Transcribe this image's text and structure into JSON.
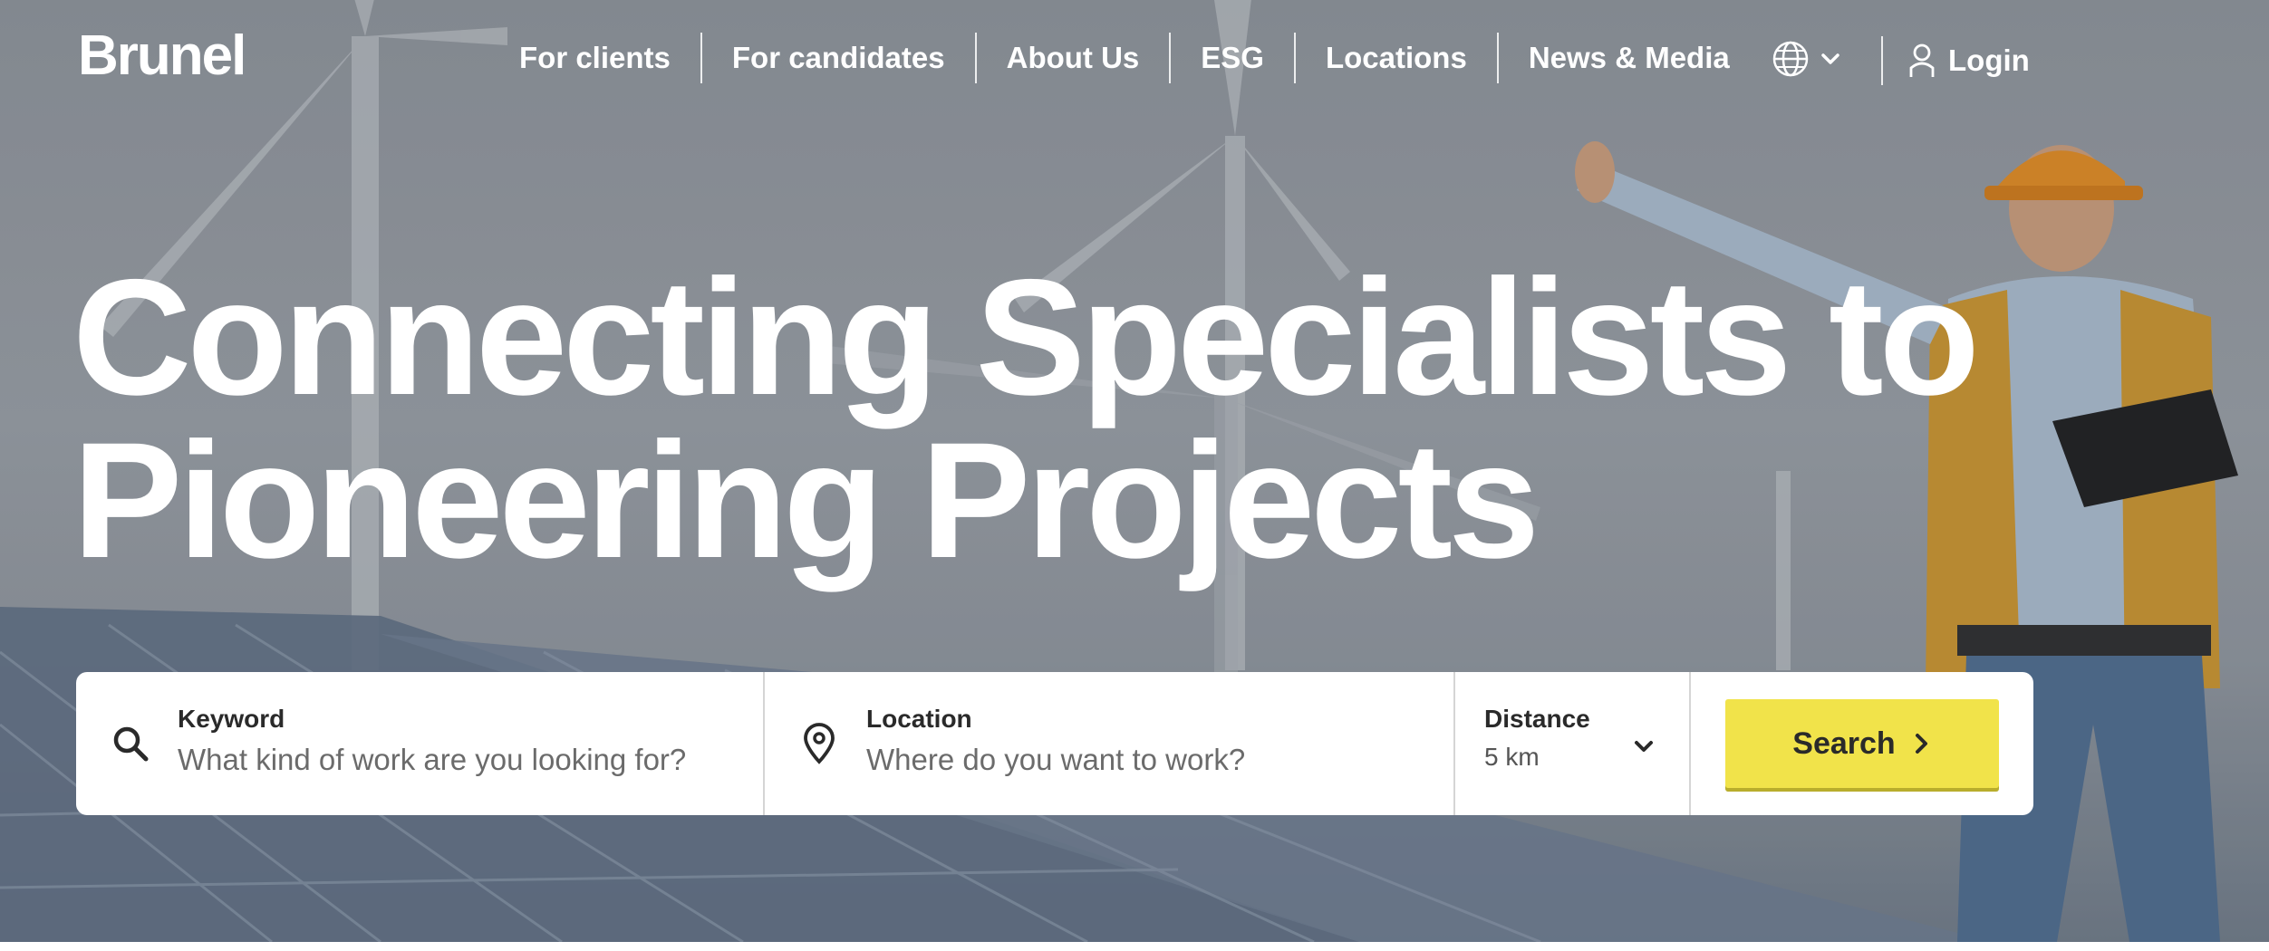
{
  "brand": {
    "logo_text": "Brunel"
  },
  "nav": {
    "items": [
      {
        "label": "For clients"
      },
      {
        "label": "For candidates"
      },
      {
        "label": "About Us"
      },
      {
        "label": "ESG"
      },
      {
        "label": "Locations"
      },
      {
        "label": "News & Media"
      }
    ],
    "language_icon": "globe-icon",
    "login_label": "Login",
    "login_icon": "user-icon"
  },
  "hero": {
    "headline_line1": "Connecting Specialists to",
    "headline_line2": "Pioneering Projects"
  },
  "search": {
    "keyword": {
      "label": "Keyword",
      "placeholder": "What kind of work are you looking for?",
      "value": "",
      "icon": "search-icon"
    },
    "location": {
      "label": "Location",
      "placeholder": "Where do you want to work?",
      "value": "",
      "icon": "map-pin-icon"
    },
    "distance": {
      "label": "Distance",
      "value": "5 km",
      "icon": "chevron-down-icon"
    },
    "button_label": "Search",
    "button_icon": "chevron-right-icon"
  },
  "colors": {
    "accent": "#f1e34a",
    "text_dark": "#2a2a2a",
    "white": "#ffffff"
  }
}
